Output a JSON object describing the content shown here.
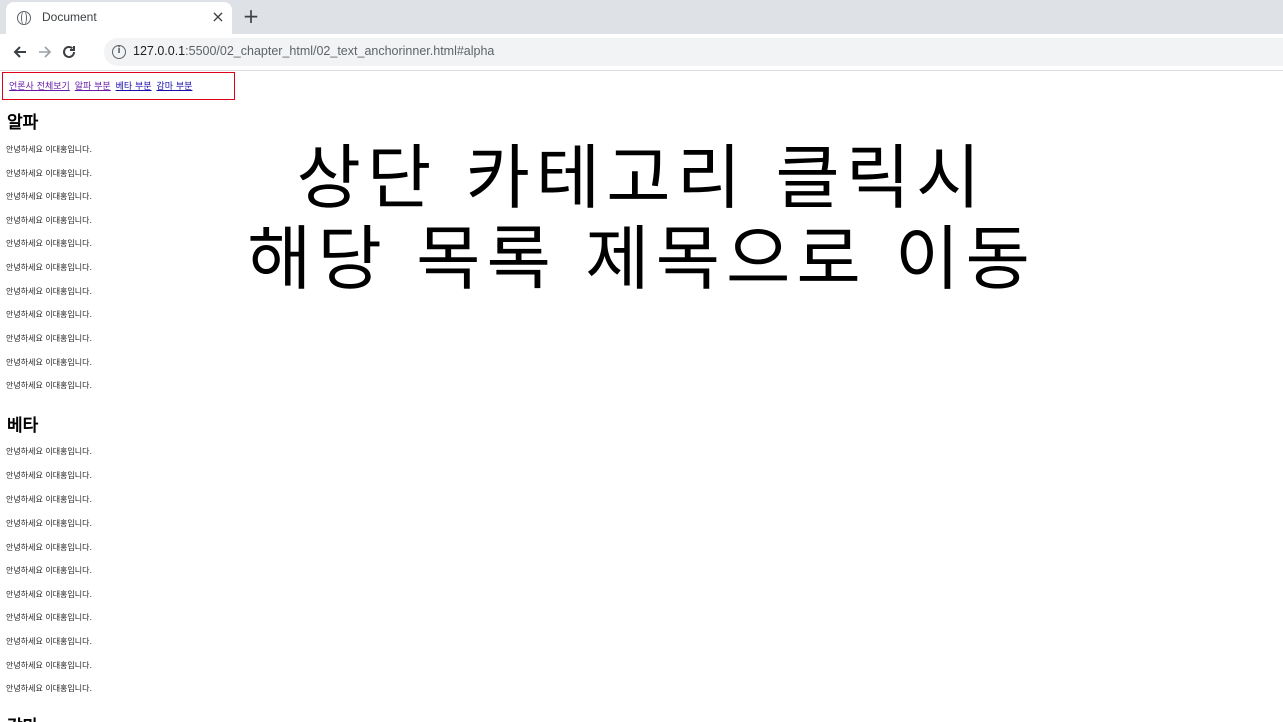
{
  "browser": {
    "tab_title": "Document",
    "tab_close": "×",
    "new_tab": "+",
    "url_host": "127.0.0.1",
    "url_rest": ":5500/02_chapter_html/02_text_anchorinner.html#alpha"
  },
  "nav": {
    "links": [
      "언론사 전체보기",
      "알파 부분",
      "베타 부분",
      "감마 부분"
    ]
  },
  "sections": [
    {
      "title": "알파",
      "paragraphs": [
        "안녕하세요 이대홍입니다.",
        "안녕하세요 이대홍입니다.",
        "안녕하세요 이대홍입니다.",
        "안녕하세요 이대홍입니다.",
        "안녕하세요 이대홍입니다.",
        "안녕하세요 이대홍입니다.",
        "안녕하세요 이대홍입니다.",
        "안녕하세요 이대홍입니다.",
        "안녕하세요 이대홍입니다.",
        "안녕하세요 이대홍입니다.",
        "안녕하세요 이대홍입니다."
      ]
    },
    {
      "title": "베타",
      "paragraphs": [
        "안녕하세요 이대홍입니다.",
        "안녕하세요 이대홍입니다.",
        "안녕하세요 이대홍입니다.",
        "안녕하세요 이대홍입니다.",
        "안녕하세요 이대홍입니다.",
        "안녕하세요 이대홍입니다.",
        "안녕하세요 이대홍입니다.",
        "안녕하세요 이대홍입니다.",
        "안녕하세요 이대홍입니다.",
        "안녕하세요 이대홍입니다.",
        "안녕하세요 이대홍입니다."
      ]
    },
    {
      "title": "감마",
      "paragraphs": []
    }
  ],
  "overlay": {
    "line1": "상단 카테고리 클릭시",
    "line2": "해당 목록 제목으로 이동"
  }
}
